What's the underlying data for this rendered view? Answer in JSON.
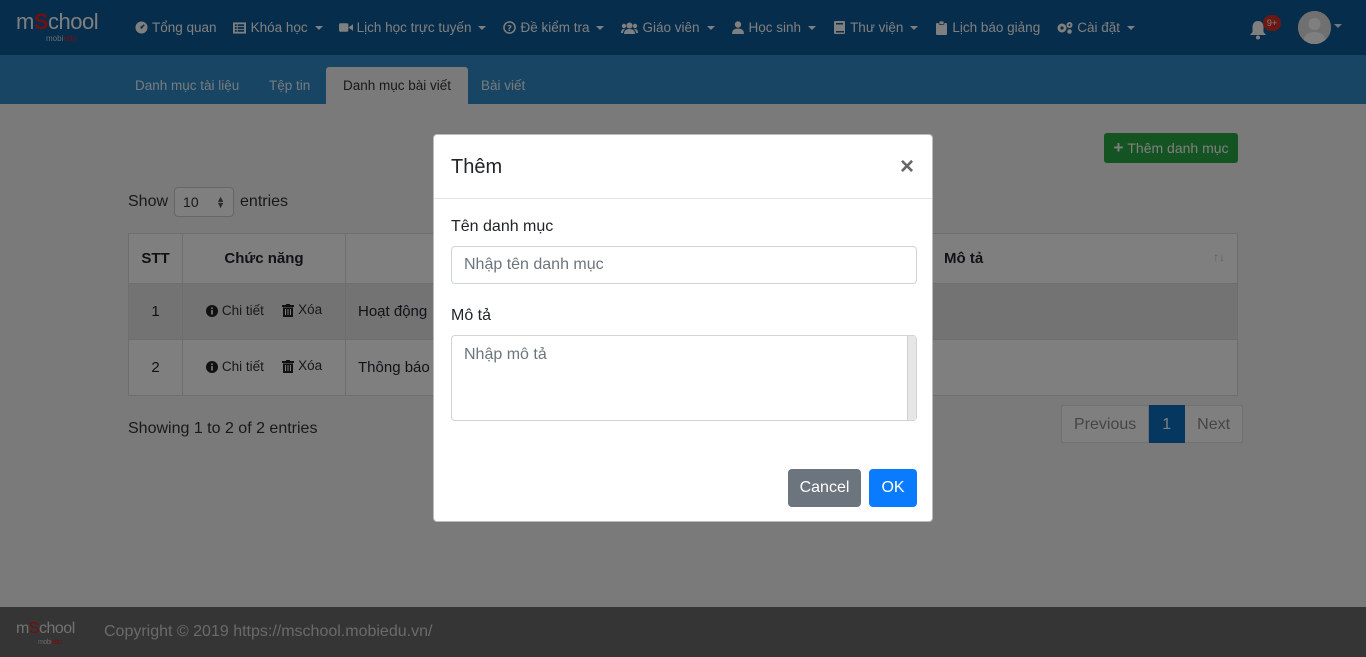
{
  "brand": {
    "name_prefix": "m",
    "name_accent": "S",
    "name_suffix": "chool",
    "sub_prefix": "mobi",
    "sub_accent": "edu"
  },
  "nav": [
    {
      "label": "Tổng quan",
      "icon": "dashboard-icon",
      "has_caret": false
    },
    {
      "label": "Khóa học",
      "icon": "list-icon",
      "has_caret": true
    },
    {
      "label": "Lịch học trực tuyến",
      "icon": "video-icon",
      "has_caret": true
    },
    {
      "label": "Đề kiểm tra",
      "icon": "question-circle-icon",
      "has_caret": true
    },
    {
      "label": "Giáo viên",
      "icon": "users-icon",
      "has_caret": true
    },
    {
      "label": "Học sinh",
      "icon": "user-icon",
      "has_caret": true
    },
    {
      "label": "Thư viện",
      "icon": "book-icon",
      "has_caret": true
    },
    {
      "label": "Lịch báo giảng",
      "icon": "clipboard-icon",
      "has_caret": false
    },
    {
      "label": "Cài đặt",
      "icon": "cogs-icon",
      "has_caret": true
    }
  ],
  "notifications": {
    "badge": "9+"
  },
  "tabs": [
    "Danh mục tài liệu",
    "Tệp tin",
    "Danh mục bài viết",
    "Bài viết"
  ],
  "active_tab": "Danh mục bài viết",
  "add_button": "Thêm danh mục",
  "show": {
    "prefix": "Show",
    "value": "10",
    "suffix": "entries"
  },
  "table": {
    "headers": [
      "STT",
      "Chức năng",
      "",
      "Mô tả"
    ],
    "actions": {
      "detail": "Chi tiết",
      "delete": "Xóa"
    },
    "rows": [
      {
        "stt": "1",
        "name": "Hoạt động",
        "desc": ""
      },
      {
        "stt": "2",
        "name": "Thông báo",
        "desc": ""
      }
    ]
  },
  "info": "Showing 1 to 2 of 2 entries",
  "pagination": {
    "previous": "Previous",
    "current": "1",
    "next": "Next"
  },
  "footer": {
    "brand": "mSchool",
    "sub": "mobiedu",
    "copyright": "Copyright © 2019 https://mschool.mobiedu.vn/"
  },
  "modal": {
    "title": "Thêm",
    "close": "×",
    "name_label": "Tên danh mục",
    "name_placeholder": "Nhập tên danh mục",
    "desc_label": "Mô tả",
    "desc_placeholder": "Nhập mô tả",
    "cancel": "Cancel",
    "ok": "OK"
  },
  "colors": {
    "navbar": "#0c5a96",
    "subnav": "#2e8bc6",
    "success": "#28a745",
    "primary": "#0b7bfe",
    "secondary": "#6c757d",
    "badge": "#d9322b"
  }
}
